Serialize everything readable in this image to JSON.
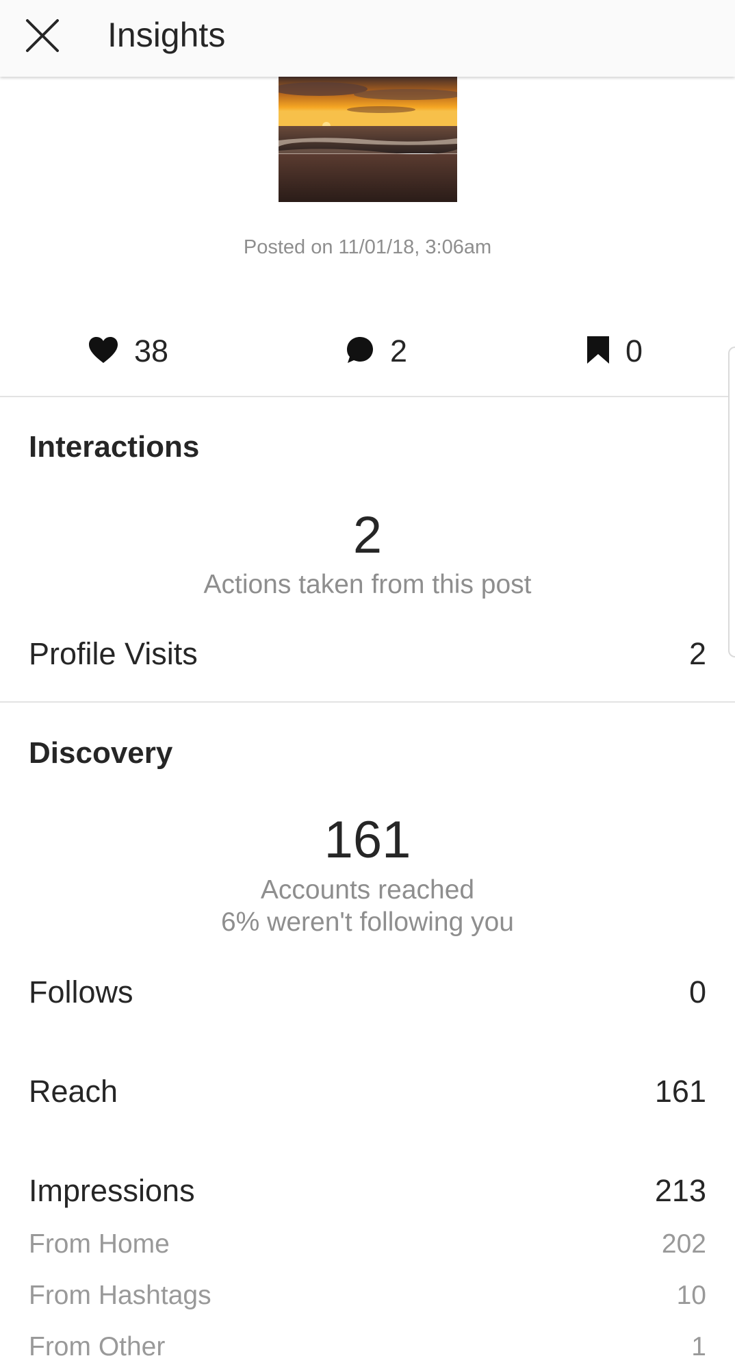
{
  "header": {
    "title": "Insights",
    "close_icon": "close-icon"
  },
  "post": {
    "posted_text": "Posted on 11/01/18, 3:06am"
  },
  "stats": {
    "likes": {
      "icon": "heart-icon",
      "value": "38"
    },
    "comments": {
      "icon": "comment-icon",
      "value": "2"
    },
    "saves": {
      "icon": "bookmark-icon",
      "value": "0"
    }
  },
  "interactions": {
    "title": "Interactions",
    "total": "2",
    "caption": "Actions taken from this post",
    "rows": [
      {
        "label": "Profile Visits",
        "value": "2"
      }
    ]
  },
  "discovery": {
    "title": "Discovery",
    "total": "161",
    "caption": "Accounts reached",
    "caption2": "6% weren't following you",
    "follows": {
      "label": "Follows",
      "value": "0"
    },
    "reach": {
      "label": "Reach",
      "value": "161"
    },
    "impressions": {
      "label": "Impressions",
      "value": "213"
    },
    "sources": [
      {
        "label": "From Home",
        "value": "202"
      },
      {
        "label": "From Hashtags",
        "value": "10"
      },
      {
        "label": "From Other",
        "value": "1"
      }
    ]
  },
  "colors": {
    "text_primary": "#262626",
    "text_secondary": "#8e8e8e",
    "divider": "#e3e3e3",
    "header_bg": "#fafafa"
  }
}
